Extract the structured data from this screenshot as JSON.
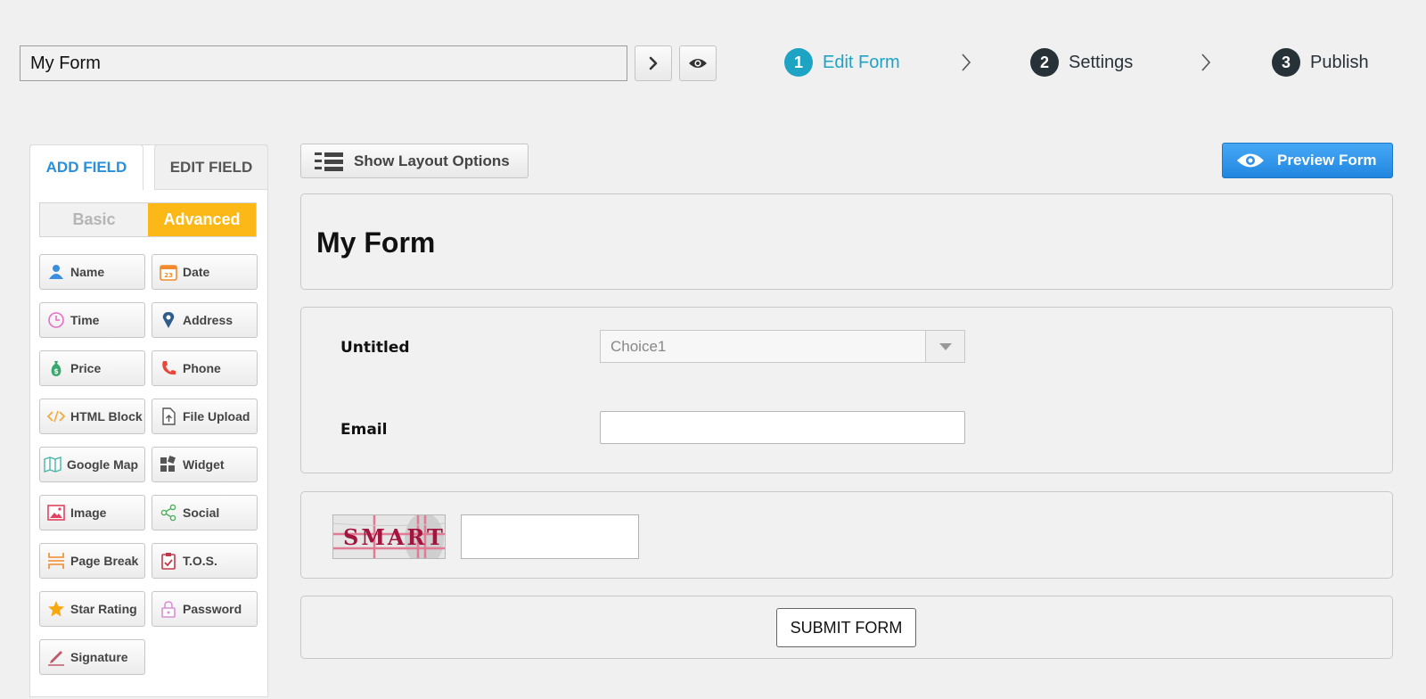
{
  "header": {
    "form_name": "My Form",
    "next_icon": "chevron-right-icon",
    "preview_icon": "eye-icon",
    "steps": [
      {
        "number": "1",
        "label": "Edit Form",
        "active": true
      },
      {
        "number": "2",
        "label": "Settings",
        "active": false
      },
      {
        "number": "3",
        "label": "Publish",
        "active": false
      }
    ]
  },
  "sidebar": {
    "tabs": {
      "add": "ADD FIELD",
      "edit": "EDIT FIELD"
    },
    "toggle": {
      "basic": "Basic",
      "advanced": "Advanced",
      "selected": "Advanced"
    },
    "fields": [
      {
        "label": "Name",
        "icon": "user-icon"
      },
      {
        "label": "Date",
        "icon": "calendar-icon"
      },
      {
        "label": "Time",
        "icon": "clock-icon"
      },
      {
        "label": "Address",
        "icon": "map-pin-icon"
      },
      {
        "label": "Price",
        "icon": "money-bag-icon"
      },
      {
        "label": "Phone",
        "icon": "phone-icon"
      },
      {
        "label": "HTML Block",
        "icon": "code-icon"
      },
      {
        "label": "File Upload",
        "icon": "file-upload-icon"
      },
      {
        "label": "Google Map",
        "icon": "map-icon"
      },
      {
        "label": "Widget",
        "icon": "widget-icon"
      },
      {
        "label": "Image",
        "icon": "image-icon"
      },
      {
        "label": "Social",
        "icon": "share-icon"
      },
      {
        "label": "Page Break",
        "icon": "page-break-icon"
      },
      {
        "label": "T.O.S.",
        "icon": "clipboard-check-icon"
      },
      {
        "label": "Star Rating",
        "icon": "star-icon"
      },
      {
        "label": "Password",
        "icon": "lock-icon"
      },
      {
        "label": "Signature",
        "icon": "pen-icon"
      }
    ]
  },
  "toolbar": {
    "layout_label": "Show Layout Options",
    "preview_label": "Preview Form"
  },
  "form": {
    "title": "My Form",
    "fields": [
      {
        "label": "Untitled",
        "type": "select",
        "value": "Choice1"
      },
      {
        "label": "Email",
        "type": "text",
        "value": ""
      }
    ],
    "captcha_text": "SMART",
    "submit_label": "SUBMIT FORM"
  },
  "colors": {
    "accent": "#1da3c3",
    "step_dark": "#263238",
    "tab_blue": "#2a8fdc",
    "advanced": "#fbb817",
    "preview_button": "#2a8fe6"
  }
}
